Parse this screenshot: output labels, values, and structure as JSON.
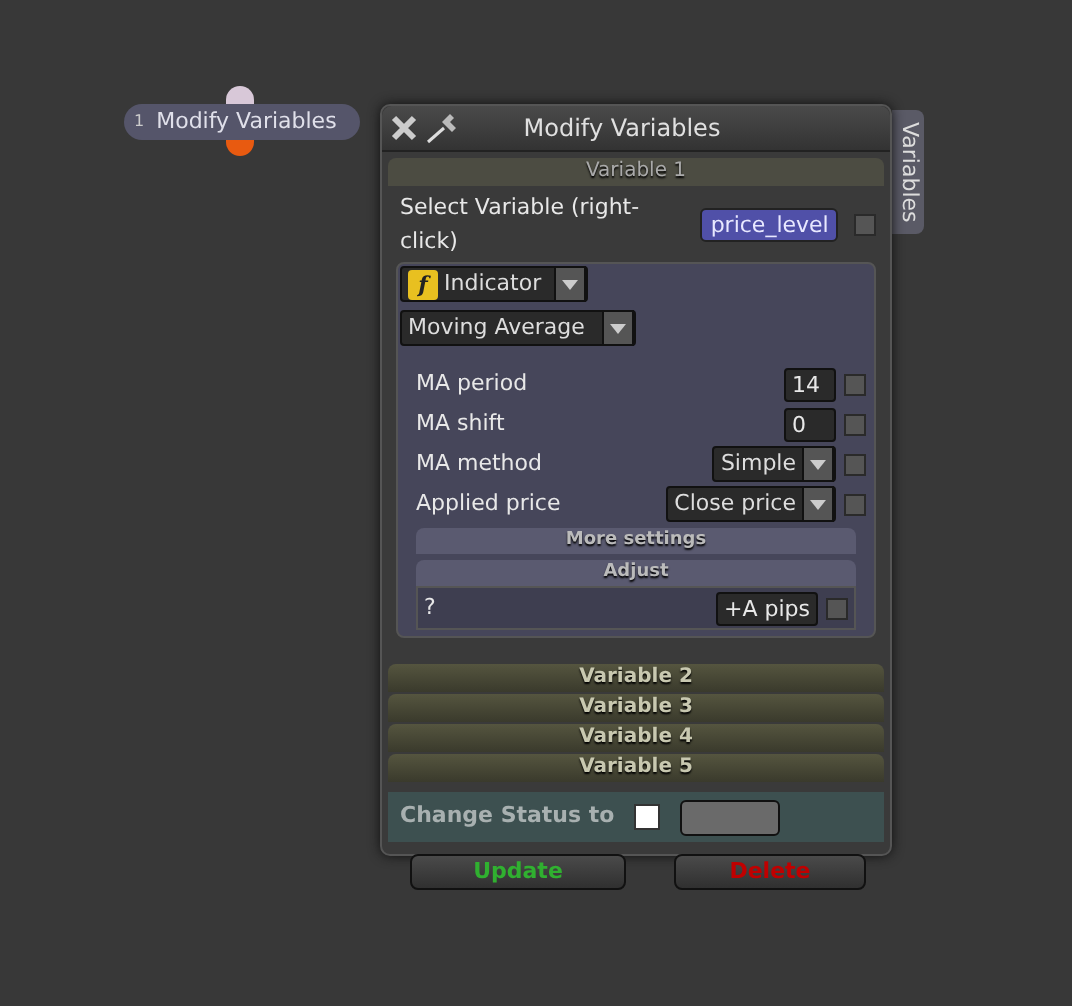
{
  "node": {
    "number": "1",
    "label": "Modify Variables"
  },
  "panel": {
    "title": "Modify Variables",
    "side_tab": "Variables",
    "variable_1": {
      "header": "Variable 1",
      "select_label": "Select Variable (right-click)",
      "variable": "price_level",
      "variable_checked": false,
      "source_icon": "f",
      "source": "Indicator",
      "indicator": "Moving Average",
      "parameters": [
        {
          "kind": "number",
          "label": "MA period",
          "value": "14",
          "checked": false
        },
        {
          "kind": "number",
          "label": "MA shift",
          "value": "0",
          "checked": false
        },
        {
          "kind": "select",
          "label": "MA method",
          "value": "Simple",
          "checked": false
        },
        {
          "kind": "select",
          "label": "Applied price",
          "value": "Close price",
          "checked": false
        }
      ],
      "more_settings": "More settings",
      "adjust_header": "Adjust",
      "adjust_label": "?",
      "adjust_value": "+A pips",
      "adjust_checked": false
    },
    "collapsed_variables": [
      "Variable 2",
      "Variable 3",
      "Variable 4",
      "Variable 5"
    ],
    "status": {
      "label": "Change Status to",
      "checked": false
    },
    "buttons": [
      {
        "kind": "update",
        "label": "Update"
      },
      {
        "kind": "delete",
        "label": "Delete"
      }
    ]
  }
}
